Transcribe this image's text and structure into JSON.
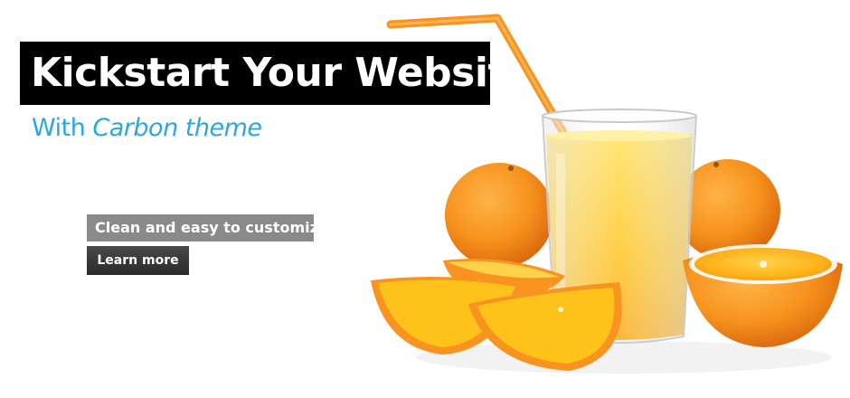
{
  "hero": {
    "headline": "Kickstart Your Website",
    "subhead_prefix": "With",
    "subhead_emphasis": "Carbon theme",
    "tagline": "Clean and easy to customize",
    "cta_label": "Learn more"
  },
  "colors": {
    "accent": "#29a8e0",
    "headline_bg": "#000000",
    "tagline_bg": "#8a8a8a",
    "cta_bg": "#333333",
    "orange": "#f7931e",
    "juice": "#ffc21a"
  },
  "icons": {
    "illustration": "orange-juice-illustration"
  }
}
